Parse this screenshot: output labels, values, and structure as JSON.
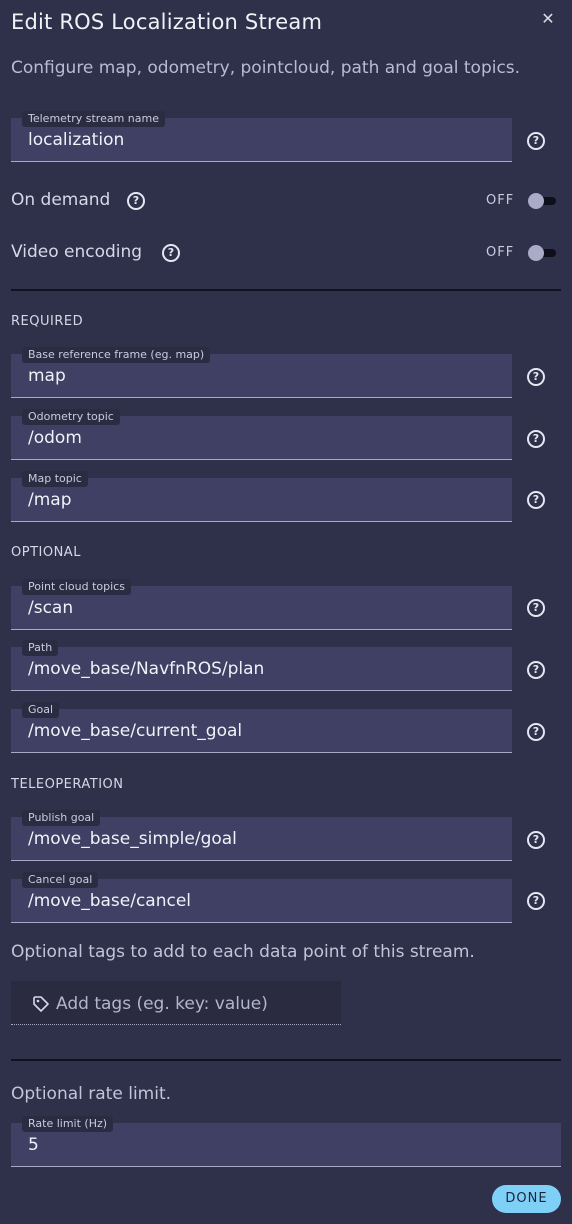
{
  "dialog": {
    "title": "Edit ROS Localization Stream",
    "close_glyph": "✕",
    "subtitle": "Configure map, odometry, pointcloud, path and goal topics."
  },
  "stream_name": {
    "label": "Telemetry stream name",
    "value": "localization"
  },
  "on_demand": {
    "label": "On demand",
    "state_text": "OFF",
    "on": false
  },
  "video_encoding": {
    "label": "Video encoding",
    "state_text": "OFF",
    "on": false
  },
  "required": {
    "heading": "REQUIRED",
    "base_frame": {
      "label": "Base reference frame (eg. map)",
      "value": "map"
    },
    "odometry": {
      "label": "Odometry topic",
      "value": "/odom"
    },
    "map": {
      "label": "Map topic",
      "value": "/map"
    }
  },
  "optional": {
    "heading": "OPTIONAL",
    "pointcloud": {
      "label": "Point cloud topics",
      "value": "/scan"
    },
    "path": {
      "label": "Path",
      "value": "/move_base/NavfnROS/plan"
    },
    "goal": {
      "label": "Goal",
      "value": "/move_base/current_goal"
    }
  },
  "teleoperation": {
    "heading": "TELEOPERATION",
    "publish_goal": {
      "label": "Publish goal",
      "value": "/move_base_simple/goal"
    },
    "cancel_goal": {
      "label": "Cancel goal",
      "value": "/move_base/cancel"
    }
  },
  "tags": {
    "description": "Optional tags to add to each data point of this stream.",
    "placeholder": "Add tags (eg. key: value)",
    "icon": "tag-icon"
  },
  "rate_limit": {
    "description": "Optional rate limit.",
    "label": "Rate limit (Hz)",
    "value": "5"
  },
  "help_glyph": "?",
  "done_label": "DONE",
  "colors": {
    "background": "#2f304a",
    "field": "#3f4063",
    "accent": "#7fd0f7"
  }
}
